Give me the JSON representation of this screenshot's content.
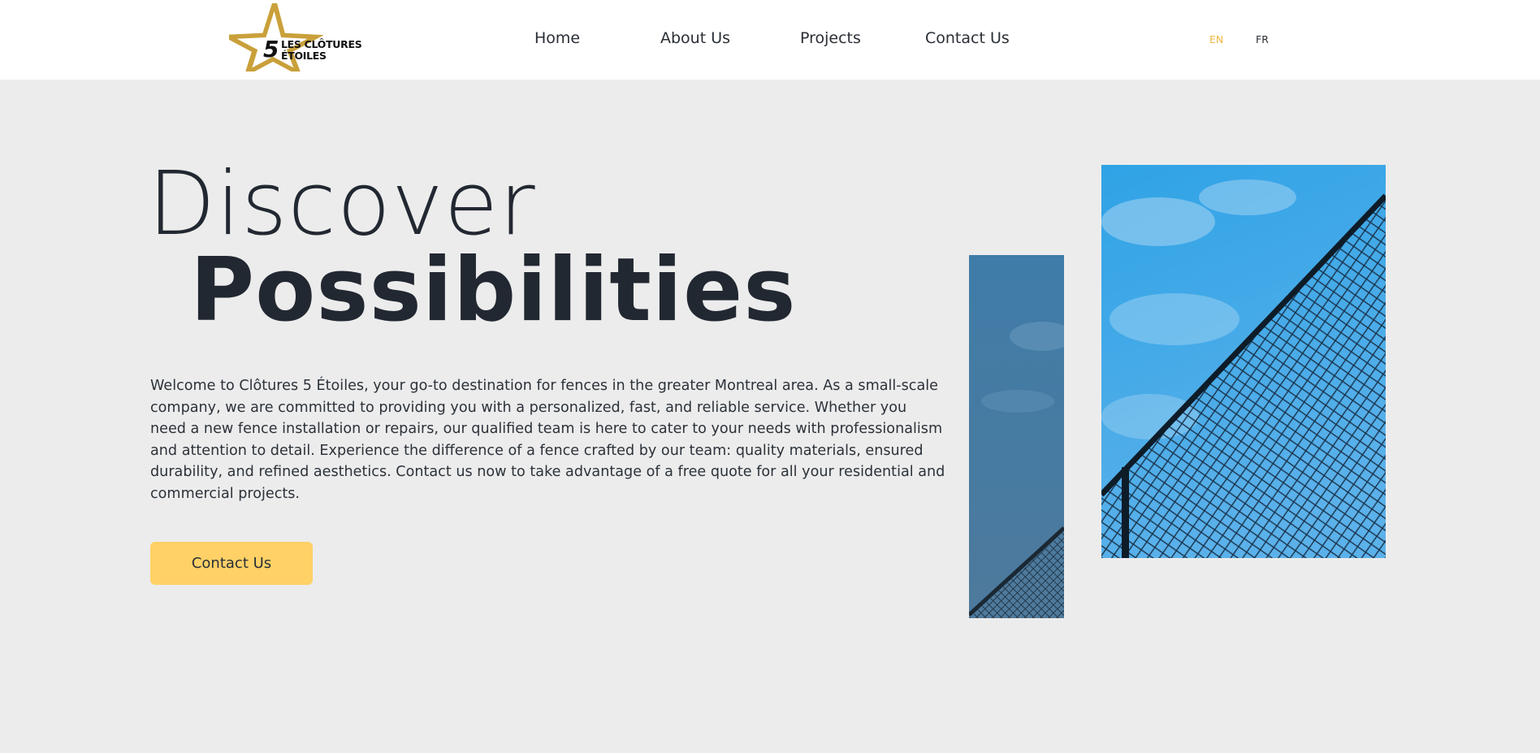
{
  "header": {
    "logo": {
      "line1": "LES CLÔTURES",
      "line2": "ÉTOILES",
      "mark": "5",
      "icon": "star-logo-icon"
    },
    "nav": [
      {
        "label": "Home"
      },
      {
        "label": "About Us"
      },
      {
        "label": "Projects"
      },
      {
        "label": "Contact Us"
      }
    ],
    "languages": [
      {
        "code": "EN",
        "active": true
      },
      {
        "code": "FR",
        "active": false
      }
    ]
  },
  "hero": {
    "title_light": "Discover",
    "title_bold": "Possibilities",
    "description": "Welcome to Clôtures 5 Étoiles, your go-to destination for fences in the greater Montreal area. As a small-scale company, we are committed to providing you with a personalized, fast, and reliable service. Whether you need a new fence installation or repairs, our qualified team is here to cater to your needs with professionalism and attention to detail. Experience the difference of a fence crafted by our team: quality materials, ensured durability, and refined aesthetics. Contact us now to take advantage of a free quote for all your residential and commercial projects.",
    "cta_label": "Contact Us"
  },
  "images": {
    "narrow": "chain-link fence against blue sky",
    "wide": "chain-link fence against blue sky"
  },
  "colors": {
    "accent": "#ffd166",
    "logo_gold": "#c9a03a",
    "lang_active": "#f2b544",
    "text_dark": "#222831",
    "page_bg": "#ececec"
  }
}
